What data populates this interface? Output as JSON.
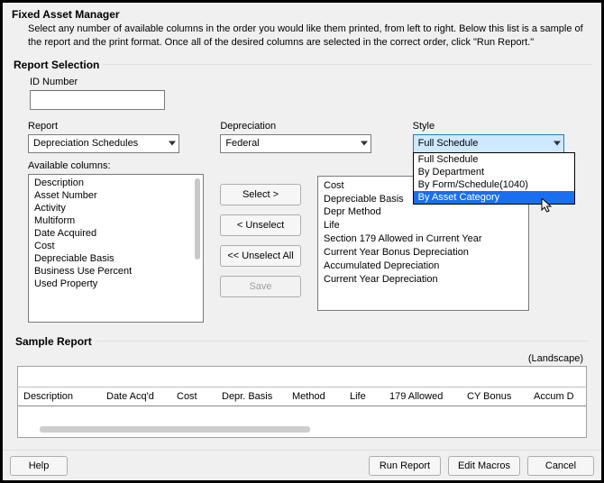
{
  "title": "Fixed Asset Manager",
  "intro": "Select any number of available columns in the order you would like them printed, from left to right. Below this list is a sample of the report and the print format. Once all of the desired columns are selected in the correct order, click \"Run Report.\"",
  "report_selection": {
    "legend": "Report Selection",
    "id_label": "ID Number",
    "id_value": ""
  },
  "fields": {
    "report": {
      "label": "Report",
      "value": "Depreciation Schedules"
    },
    "depreciation": {
      "label": "Depreciation",
      "value": "Federal"
    },
    "style": {
      "label": "Style",
      "value": "Full Schedule",
      "options": [
        "Full Schedule",
        "By Department",
        "By Form/Schedule(1040)",
        "By Asset Category"
      ],
      "highlight_index": 3
    }
  },
  "available": {
    "label": "Available columns:",
    "items": [
      "Description",
      "Asset Number",
      "Activity",
      "Multiform",
      "Date Acquired",
      "Cost",
      "Depreciable Basis",
      "Business Use Percent",
      "Used Property"
    ]
  },
  "buttons": {
    "select": "Select >",
    "unselect": "< Unselect",
    "unselect_all": "<< Unselect All",
    "save": "Save"
  },
  "selected": {
    "items": [
      "Cost",
      "Depreciable Basis",
      "Depr Method",
      "Life",
      "Section 179 Allowed in Current Year",
      "Current Year Bonus Depreciation",
      "Accumulated Depreciation",
      "Current Year Depreciation"
    ]
  },
  "sample": {
    "legend": "Sample Report",
    "orientation": "(Landscape)",
    "headers": [
      "Description",
      "Date Acq'd",
      "Cost",
      "Depr. Basis",
      "Method",
      "Life",
      "179 Allowed",
      "CY Bonus",
      "Accum D"
    ]
  },
  "footer": {
    "help": "Help",
    "run": "Run Report",
    "macros": "Edit Macros",
    "cancel": "Cancel"
  }
}
